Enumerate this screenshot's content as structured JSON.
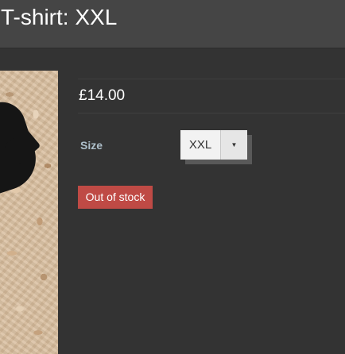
{
  "header": {
    "title": "T-shirt: XXL"
  },
  "product": {
    "price": "£14.00",
    "image_alt": "T-shirt",
    "size": {
      "label": "Size",
      "selected": "XXL",
      "caret_icon": "caret-down-icon"
    },
    "stock_status": "Out of stock"
  },
  "colors": {
    "background": "#333333",
    "header": "#454545",
    "stock_badge": "#bf4a45",
    "size_label": "#aebfca"
  }
}
